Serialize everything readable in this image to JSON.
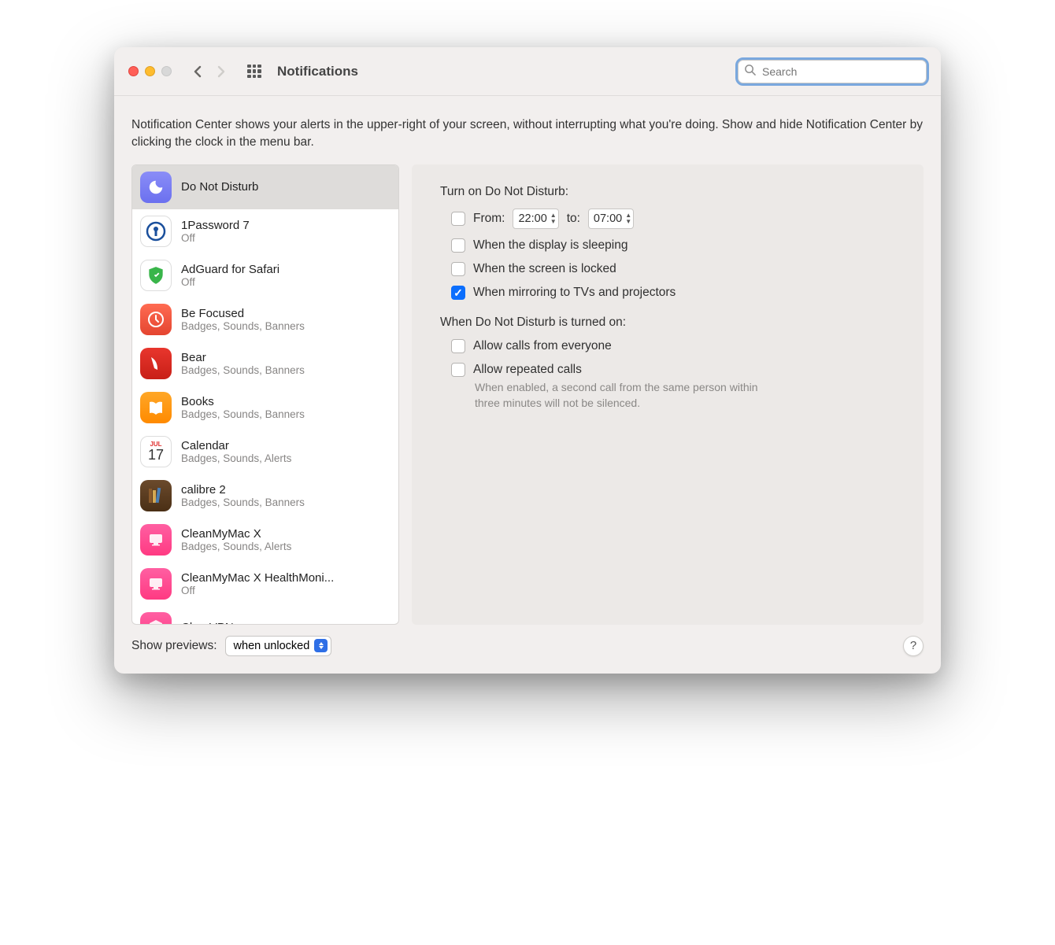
{
  "title": "Notifications",
  "search_placeholder": "Search",
  "description": "Notification Center shows your alerts in the upper-right of your screen, without interrupting what you're doing. Show and hide Notification Center by clicking the clock in the menu bar.",
  "sidebar": {
    "items": [
      {
        "name": "Do Not Disturb",
        "sub": "",
        "selected": true,
        "icon": "dnd"
      },
      {
        "name": "1Password 7",
        "sub": "Off",
        "icon": "1p"
      },
      {
        "name": "AdGuard for Safari",
        "sub": "Off",
        "icon": "adg"
      },
      {
        "name": "Be Focused",
        "sub": "Badges, Sounds, Banners",
        "icon": "bef"
      },
      {
        "name": "Bear",
        "sub": "Badges, Sounds, Banners",
        "icon": "bear"
      },
      {
        "name": "Books",
        "sub": "Badges, Sounds, Banners",
        "icon": "books"
      },
      {
        "name": "Calendar",
        "sub": "Badges, Sounds, Alerts",
        "icon": "cal"
      },
      {
        "name": "calibre 2",
        "sub": "Badges, Sounds, Banners",
        "icon": "calibre"
      },
      {
        "name": "CleanMyMac X",
        "sub": "Badges, Sounds, Alerts",
        "icon": "cmm"
      },
      {
        "name": "CleanMyMac X HealthMoni...",
        "sub": "Off",
        "icon": "cmm"
      },
      {
        "name": "ClearVPN",
        "sub": "",
        "icon": "cvpn"
      }
    ]
  },
  "dnd": {
    "turn_on_label": "Turn on Do Not Disturb:",
    "from_label": "From:",
    "from_time": "22:00",
    "to_label": "to:",
    "to_time": "07:00",
    "when_display_sleeping": "When the display is sleeping",
    "when_screen_locked": "When the screen is locked",
    "when_mirroring": "When mirroring to TVs and projectors",
    "when_on_label": "When Do Not Disturb is turned on:",
    "allow_everyone": "Allow calls from everyone",
    "allow_repeated": "Allow repeated calls",
    "repeated_help": "When enabled, a second call from the same person within three minutes will not be silenced."
  },
  "previews": {
    "label": "Show previews:",
    "value": "when unlocked"
  },
  "calendar_day": "17",
  "calendar_month": "JUL"
}
